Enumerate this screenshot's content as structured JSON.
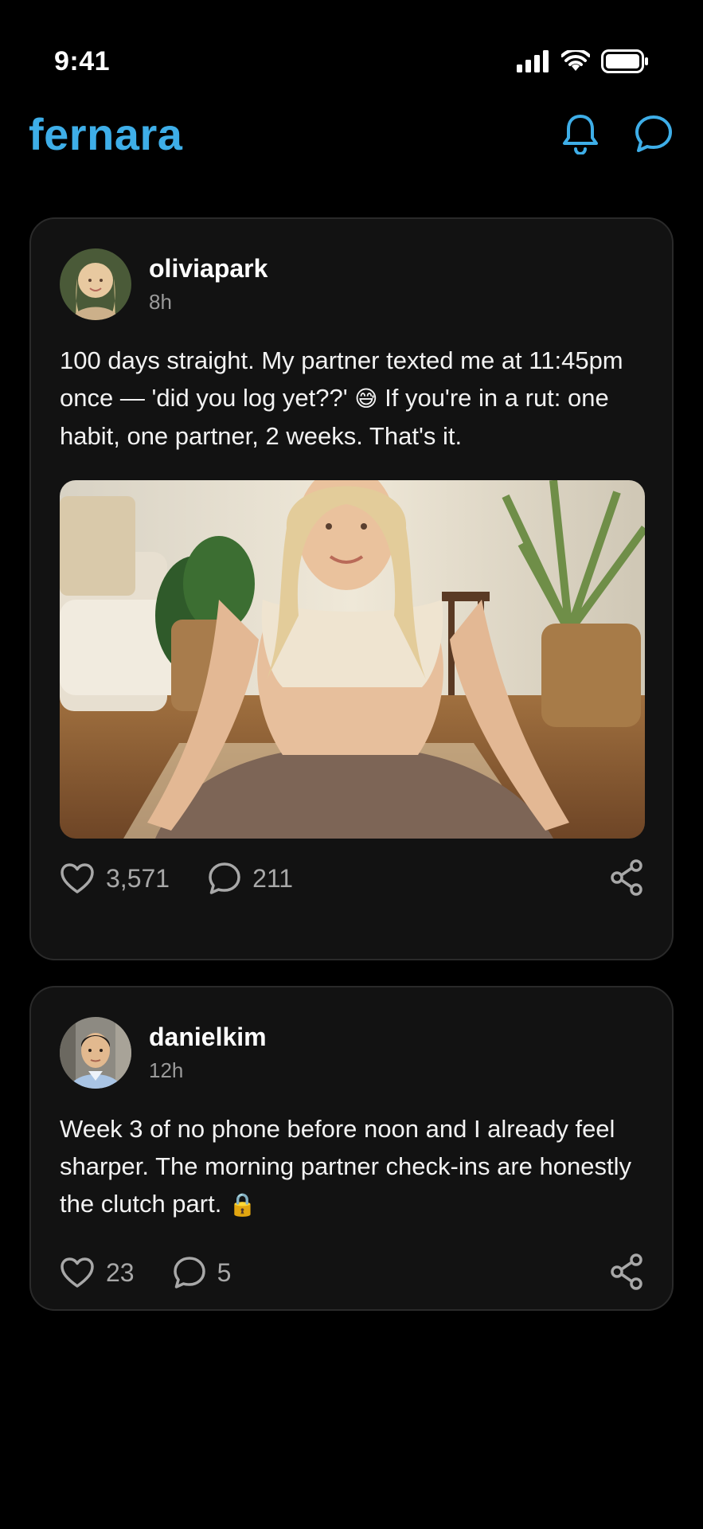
{
  "status_bar": {
    "time": "9:41"
  },
  "header": {
    "logo": "fernara",
    "accent_color": "#3eaee8",
    "notifications_icon": "bell-icon",
    "messages_icon": "chat-bubble-icon"
  },
  "posts": [
    {
      "author": "oliviapark",
      "time": "8h",
      "text_before_emoji": "100 days straight. My partner texted me at 11:45pm once — 'did you log yet??' ",
      "emoji": "😅",
      "text_after_emoji": "  If you're in a rut: one habit, one partner, 2 weeks. That's it.",
      "likes": "3,571",
      "comments": "211"
    },
    {
      "author": "danielkim",
      "time": "12h",
      "text_before_emoji": "Week 3 of no phone before noon and I already feel sharper. The morning partner check-ins are honestly the clutch part. ",
      "emoji": "🔒",
      "text_after_emoji": "",
      "likes": "23",
      "comments": "5"
    }
  ]
}
